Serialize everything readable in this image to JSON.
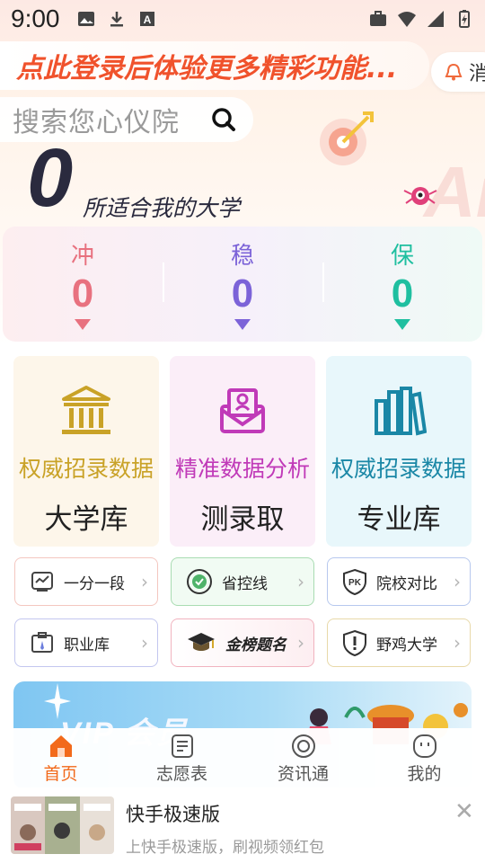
{
  "status_bar": {
    "time": "9:00",
    "left_icons": [
      "image-icon",
      "download-icon",
      "a-badge-icon"
    ],
    "right_icons": [
      "briefcase-icon",
      "wifi-icon",
      "signal-icon",
      "battery-icon"
    ]
  },
  "header": {
    "login_prompt": "点此登录后体验更多精彩功能...",
    "message_label": "消"
  },
  "search": {
    "placeholder": "搜索您心仪院"
  },
  "summary": {
    "count": "0",
    "caption": "所适合我的大学"
  },
  "strategy": [
    {
      "label": "冲",
      "value": "0",
      "color": "#e8717f"
    },
    {
      "label": "稳",
      "value": "0",
      "color": "#7c63d8"
    },
    {
      "label": "保",
      "value": "0",
      "color": "#1fbfa0"
    }
  ],
  "tiles": [
    {
      "subtitle": "权威招录数据",
      "title": "大学库",
      "icon": "university-building-icon",
      "accent": "#c9a227",
      "bg": "#fdf6ea"
    },
    {
      "subtitle": "精准数据分析",
      "title": "测录取",
      "icon": "certificate-envelope-icon",
      "accent": "#c03ab8",
      "bg": "#fbeef8"
    },
    {
      "subtitle": "权威招录数据",
      "title": "专业库",
      "icon": "books-icon",
      "accent": "#1a87a6",
      "bg": "#e8f7fb"
    }
  ],
  "shortcuts": [
    {
      "label": "一分一段",
      "icon": "score-chart-icon",
      "border": "#f4c7c0"
    },
    {
      "label": "省控线",
      "icon": "province-badge-icon",
      "border": "#a9dcb2"
    },
    {
      "label": "院校对比",
      "icon": "pk-shield-icon",
      "border": "#b7c8ee"
    },
    {
      "label": "职业库",
      "icon": "career-badge-icon",
      "border": "#c3c7ef"
    },
    {
      "label": "金榜题名",
      "icon": "graduation-cap-icon",
      "border": "#f1b3bf"
    },
    {
      "label": "野鸡大学",
      "icon": "warning-shield-icon",
      "border": "#e8d9a9"
    }
  ],
  "vip": {
    "text": "VIP 会员"
  },
  "tabs": [
    {
      "label": "首页",
      "icon": "home-icon",
      "active": true
    },
    {
      "label": "志愿表",
      "icon": "form-icon",
      "active": false
    },
    {
      "label": "资讯通",
      "icon": "news-icon",
      "active": false
    },
    {
      "label": "我的",
      "icon": "profile-icon",
      "active": false
    }
  ],
  "ad": {
    "title": "快手极速版",
    "description": "上快手极速版，刷视频领红包",
    "close": "✕"
  }
}
